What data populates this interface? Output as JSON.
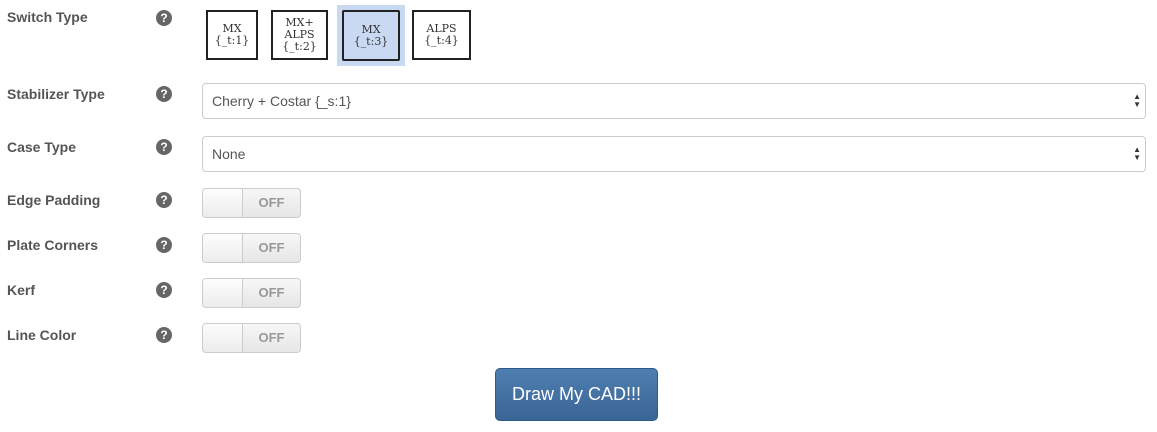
{
  "help_glyph": "?",
  "switch_type": {
    "label": "Switch Type",
    "options": [
      {
        "line1": "MX",
        "line2": "{_t:1}",
        "line3": ""
      },
      {
        "line1": "MX+",
        "line2": "ALPS",
        "line3": "{_t:2}"
      },
      {
        "line1": "MX",
        "line2": "{_t:3}",
        "line3": ""
      },
      {
        "line1": "ALPS",
        "line2": "{_t:4}",
        "line3": ""
      }
    ],
    "selected_index": 2
  },
  "stabilizer_type": {
    "label": "Stabilizer Type",
    "value": "Cherry + Costar {_s:1}"
  },
  "case_type": {
    "label": "Case Type",
    "value": "None"
  },
  "edge_padding": {
    "label": "Edge Padding",
    "state": "OFF"
  },
  "plate_corners": {
    "label": "Plate Corners",
    "state": "OFF"
  },
  "kerf": {
    "label": "Kerf",
    "state": "OFF"
  },
  "line_color": {
    "label": "Line Color",
    "state": "OFF"
  },
  "draw_button": {
    "label": "Draw My CAD!!!"
  },
  "colors": {
    "selected_bg": "#c9d9f1",
    "primary_button": "#3f6b9b"
  },
  "icons": {
    "help": "question-circle-icon",
    "select_caret": "up-down-caret-icon"
  }
}
